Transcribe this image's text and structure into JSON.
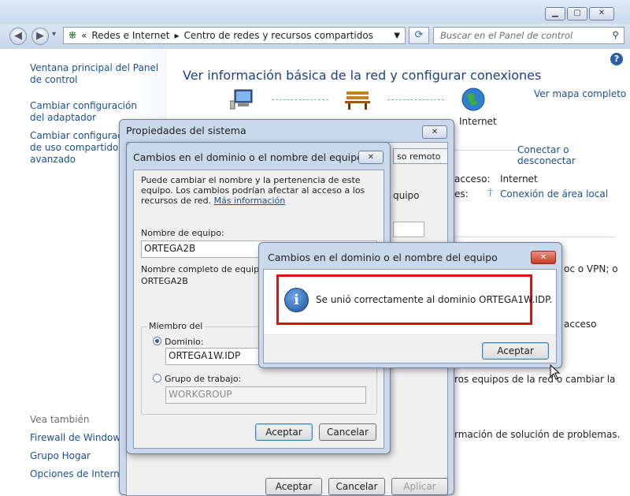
{
  "window": {
    "minimize_icon": "minimize-icon",
    "maximize_icon": "maximize-icon",
    "close_icon": "close-icon"
  },
  "address": {
    "breadcrumb_sep": "«",
    "crumb1": "Redes e Internet",
    "crumb2": "Centro de redes y recursos compartidos",
    "search_placeholder": "Buscar en el Panel de control"
  },
  "sidebar": {
    "items": [
      {
        "label": "Ventana principal del Panel de control"
      },
      {
        "label": "Cambiar configuración del adaptador"
      },
      {
        "label": "Cambiar configuración de uso compartido avanzado"
      }
    ],
    "see_also": "Vea también",
    "bottom_links": [
      {
        "label": "Firewall de Windows"
      },
      {
        "label": "Grupo Hogar"
      },
      {
        "label": "Opciones de Internet"
      }
    ]
  },
  "main": {
    "title": "Ver información básica de la red y configurar conexiones",
    "full_map": "Ver mapa completo",
    "internet_label": "Internet",
    "connect_disconnect": "Conectar o desconectar",
    "access_label": "acceso:",
    "access_value": "Internet",
    "connections_label": "es:",
    "connection_value": "Conexión de área local",
    "text_vpn": "oc o VPN; o",
    "text_acceso": "acceso",
    "text_equipos": "ros equipos de la red o cambiar la",
    "text_problemas": "rmación de solución de problemas."
  },
  "sysprops": {
    "title": "Propiedades del sistema",
    "tab_remote": "so remoto",
    "partial_text": "quipo",
    "ok": "Aceptar",
    "cancel": "Cancelar",
    "apply": "Aplicar"
  },
  "domain_dialog": {
    "title": "Cambios en el dominio o el nombre del equipo",
    "desc": "Puede cambiar el nombre y la pertenencia de este equipo. Los cambios podrían afectar al acceso a los recursos de red.",
    "more_info": "Más información",
    "computer_name_label": "Nombre de equipo:",
    "computer_name_value": "ORTEGA2B",
    "full_name_label": "Nombre completo de equipo:",
    "full_name_value": "ORTEGA2B",
    "member_of": "Miembro del",
    "domain_label": "Dominio:",
    "domain_value": "ORTEGA1W.IDP",
    "workgroup_label": "Grupo de trabajo:",
    "workgroup_value": "WORKGROUP",
    "ok": "Aceptar",
    "cancel": "Cancelar"
  },
  "message_box": {
    "title": "Cambios en el dominio o el nombre del equipo",
    "message": "Se unió correctamente al dominio ORTEGA1W.IDP.",
    "ok": "Aceptar",
    "highlight_color": "#e01010"
  }
}
